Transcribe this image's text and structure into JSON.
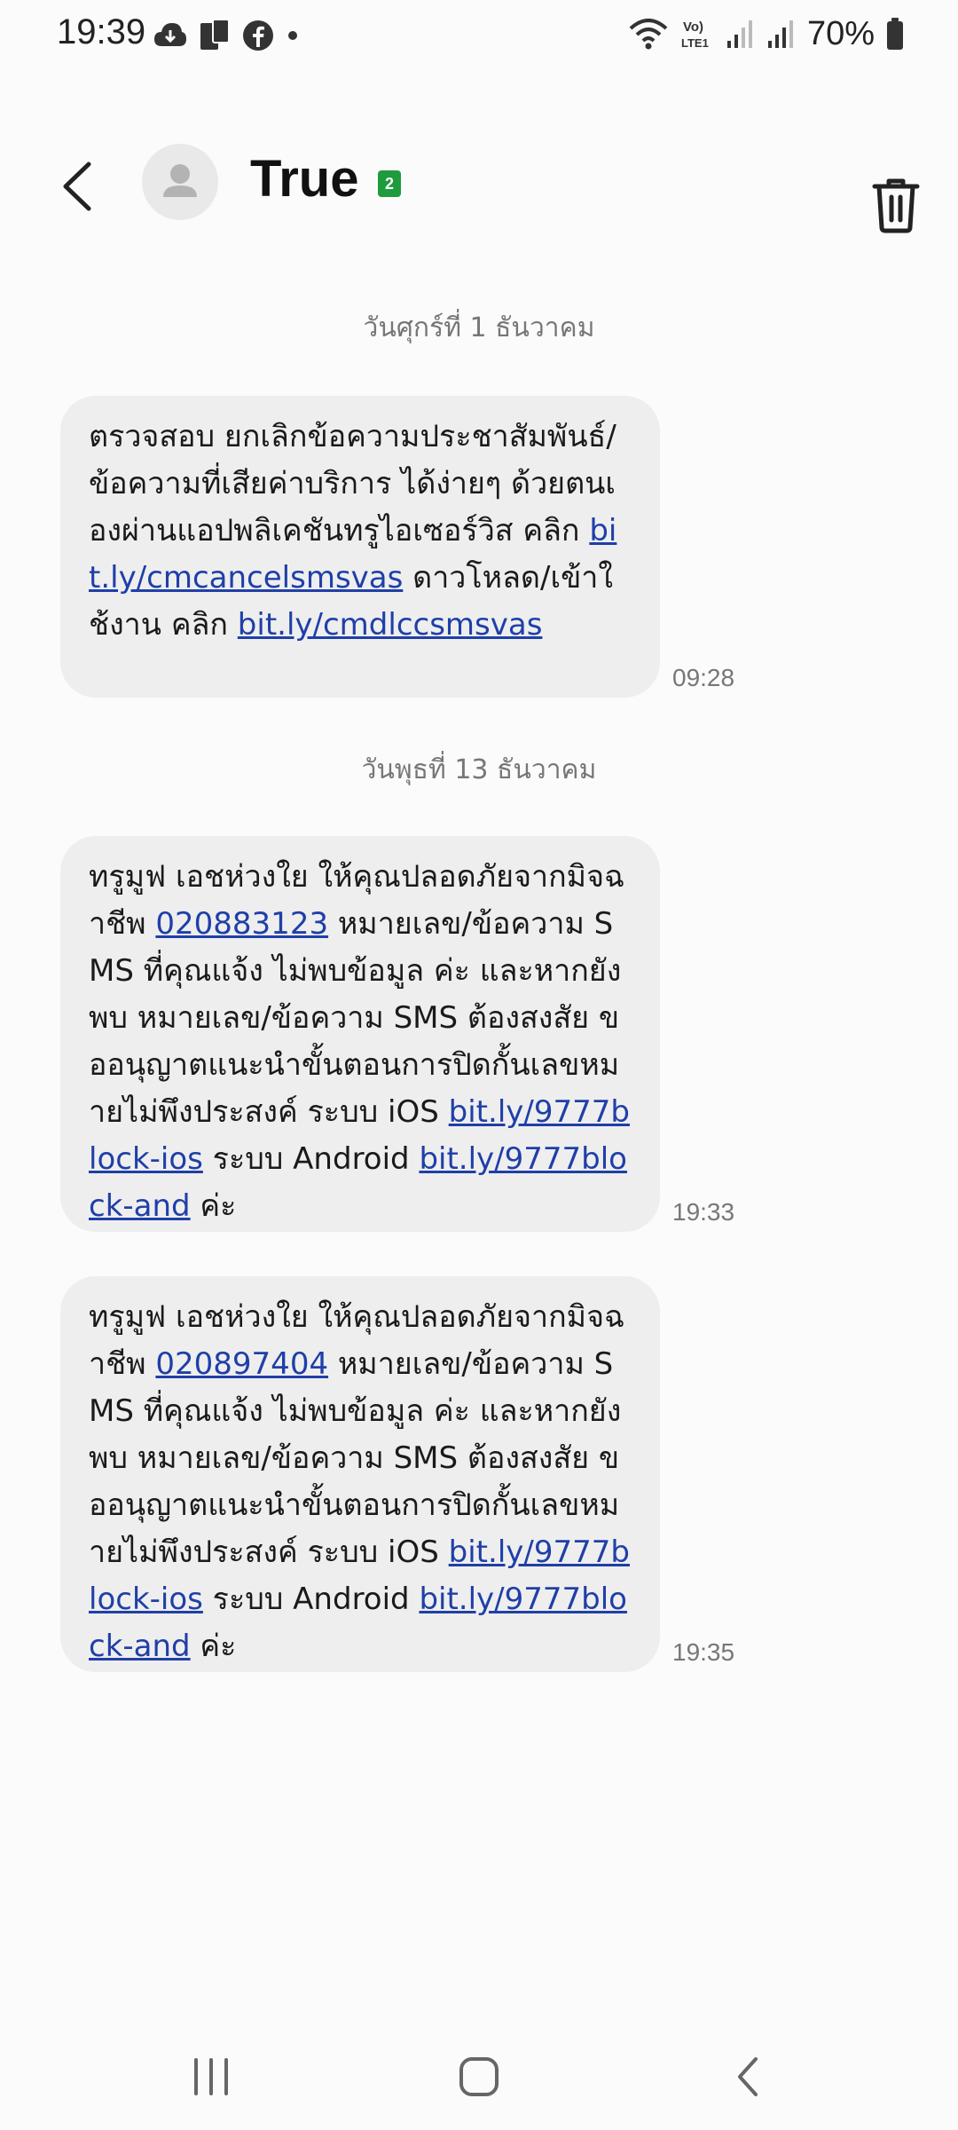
{
  "status_bar": {
    "time": "19:39",
    "left_icons": [
      "cloud-icon",
      "phone-transfer-icon",
      "facebook-icon",
      "dot-icon"
    ],
    "network_label": "Vo) LTE1",
    "battery_percent": "70%"
  },
  "header": {
    "title": "True",
    "sim_badge": "2"
  },
  "messages": [
    {
      "date": "วันศุกร์ที่ 1 ธันวาคม",
      "segments": [
        "ตรวจสอบ ยกเลิกข้อความประชาสัมพันธ์/ข้อความที่เสียค่าบริการ ได้ง่ายๆ ด้วยตนเองผ่านแอปพลิเคชันทรูไอเซอร์วิส คลิก ",
        "bit.ly/cmcancelsmsvas",
        " ดาวโหลด/เข้าใช้งาน คลิก ",
        "bit.ly/cmdlccsmsvas"
      ],
      "time": "09:28"
    },
    {
      "date": "วันพุธที่ 13 ธันวาคม",
      "segments": [
        "ทรูมูฟ เอชห่วงใย ให้คุณปลอดภัยจากมิจฉาชีพ ",
        "020883123",
        " หมายเลข/ข้อความ SMS ที่คุณแจ้ง ไม่พบข้อมูล ค่ะ และหากยังพบ หมายเลข/ข้อความ SMS ต้องสงสัย ขออนุญาตแนะนำขั้นตอนการปิดกั้นเลขหมายไม่พึงประสงค์ ระบบ iOS ",
        "bit.ly/9777block-ios",
        " ระบบ Android ",
        "bit.ly/9777block-and",
        " ค่ะ"
      ],
      "time": "19:33"
    },
    {
      "segments": [
        "ทรูมูฟ เอชห่วงใย ให้คุณปลอดภัยจากมิจฉาชีพ ",
        "020897404",
        " หมายเลข/ข้อความ SMS ที่คุณแจ้ง ไม่พบข้อมูล ค่ะ และหากยังพบ หมายเลข/ข้อความ SMS ต้องสงสัย ขออนุญาตแนะนำขั้นตอนการปิดกั้นเลขหมายไม่พึงประสงค์ ระบบ iOS ",
        "bit.ly/9777block-ios",
        " ระบบ Android ",
        "bit.ly/9777block-and",
        " ค่ะ"
      ],
      "time": "19:35"
    }
  ],
  "nav_bar": {
    "icons": [
      "recents-icon",
      "home-icon",
      "back-icon"
    ]
  },
  "colors": {
    "link": "#1f3fa8",
    "bubble": "#eeeeee",
    "sim_badge": "#1e9b3c"
  }
}
